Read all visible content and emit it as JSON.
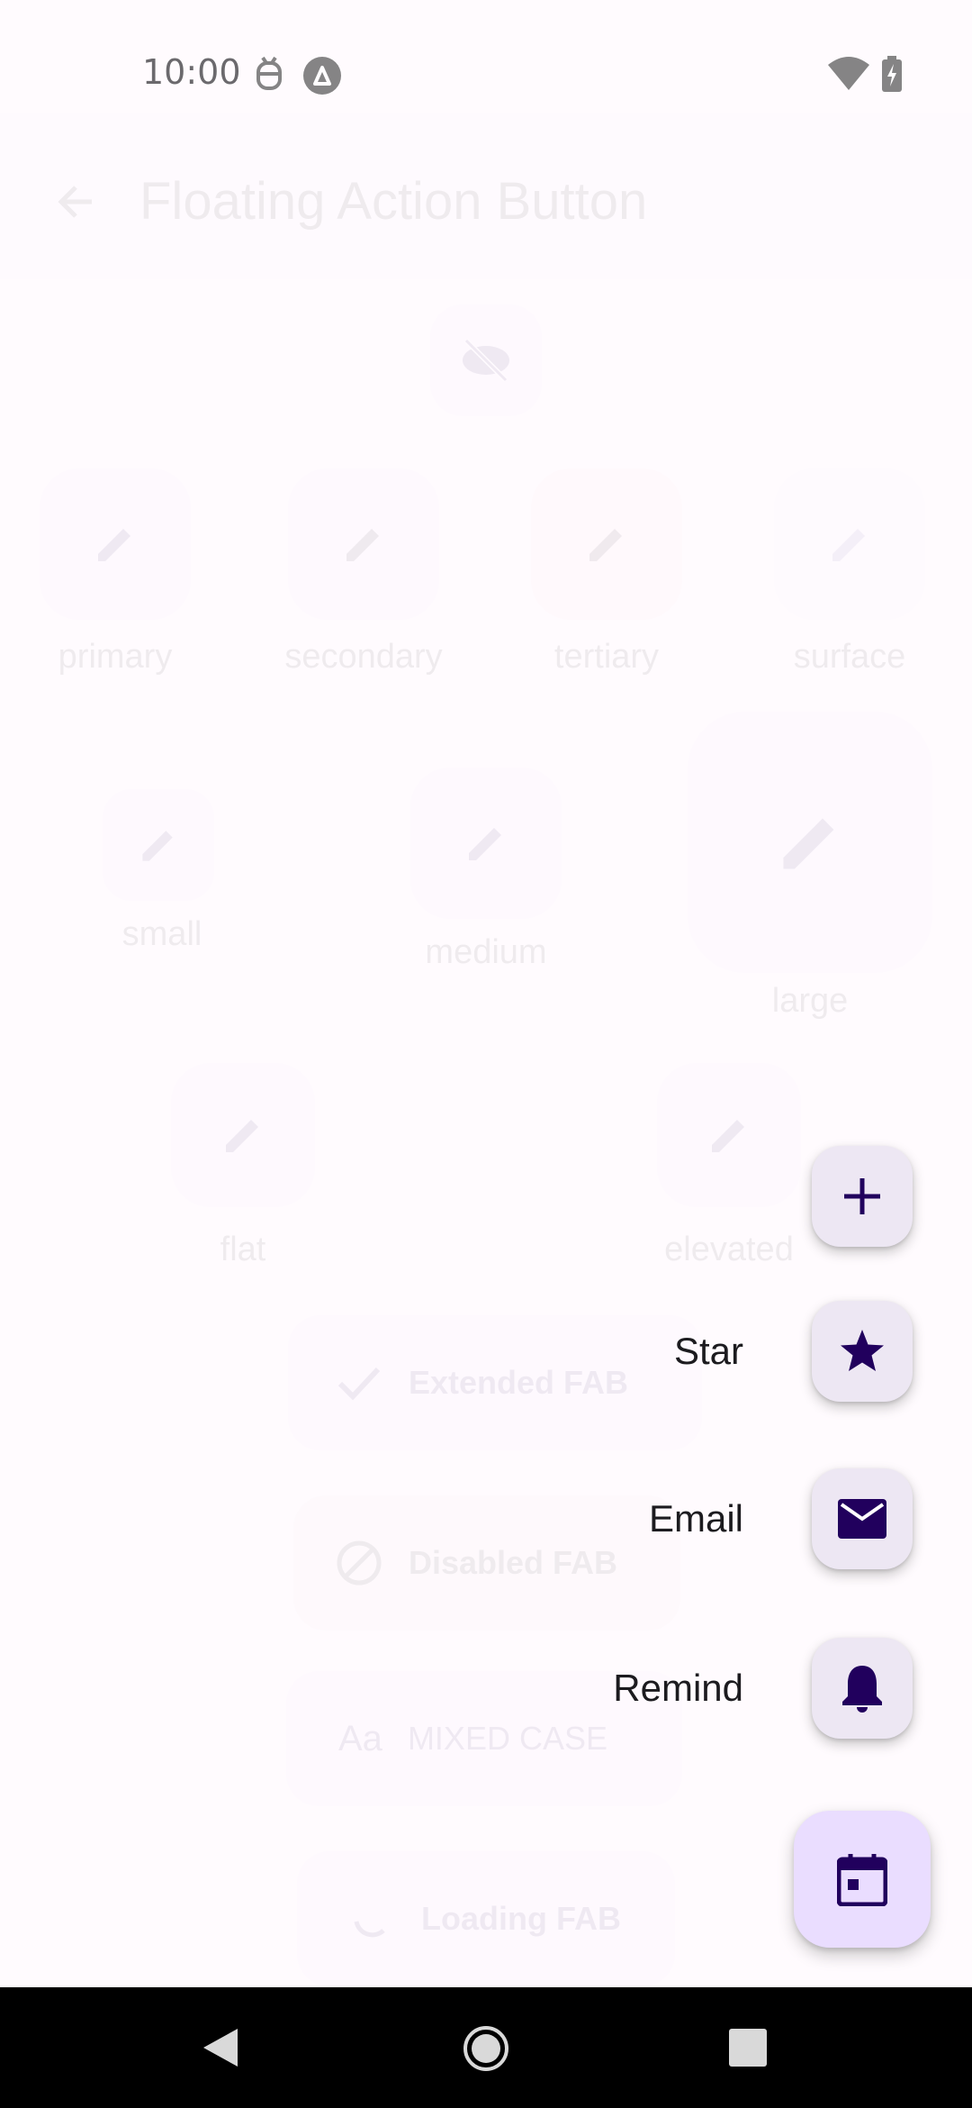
{
  "status_bar": {
    "time": "10:00"
  },
  "app_bar": {
    "title": "Floating Action Button"
  },
  "background": {
    "color_fabs": [
      {
        "label": "primary"
      },
      {
        "label": "secondary"
      },
      {
        "label": "tertiary"
      },
      {
        "label": "surface"
      }
    ],
    "size_fabs": [
      {
        "label": "small"
      },
      {
        "label": "medium"
      },
      {
        "label": "large"
      }
    ],
    "elevation_fabs": [
      {
        "label": "flat"
      },
      {
        "label": "elevated"
      }
    ],
    "extended_fabs": [
      {
        "label": "Extended FAB",
        "icon": "check-icon"
      },
      {
        "label": "Disabled FAB",
        "icon": "block-icon"
      },
      {
        "label": "MIXED CASE",
        "icon": "text-format-icon",
        "icon_text": "Aa"
      },
      {
        "label": "Loading FAB",
        "icon": "spinner-icon"
      }
    ]
  },
  "speed_dial": {
    "items": [
      {
        "label": "Star",
        "icon": "star-icon"
      },
      {
        "label": "Email",
        "icon": "mail-icon"
      },
      {
        "label": "Remind",
        "icon": "bell-icon"
      }
    ],
    "toggle_icon": "plus-icon",
    "main_icon": "calendar-icon"
  },
  "colors": {
    "fab_container": "#eaddff",
    "fab_icon": "#21005d",
    "mini_fab_container": "#ede7f3",
    "background": "#fffbfe"
  }
}
